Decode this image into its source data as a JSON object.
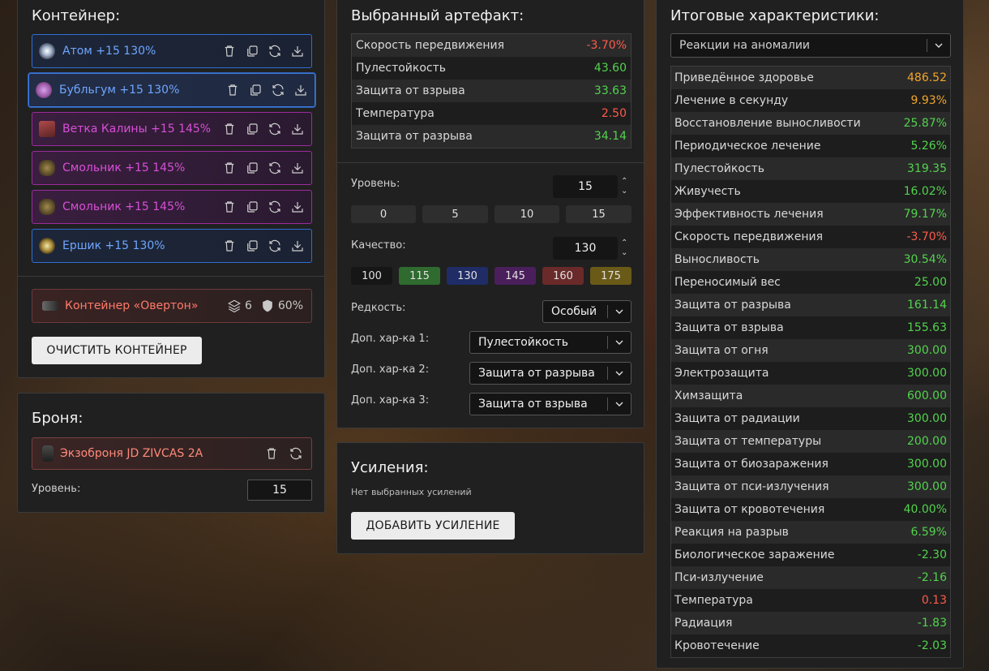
{
  "container": {
    "title": "Контейнер:",
    "artifacts": [
      {
        "label": "Атом +15 130%"
      },
      {
        "label": "Бубльгум +15 130%"
      },
      {
        "label": "Ветка Калины +15 145%"
      },
      {
        "label": "Смольник +15 145%"
      },
      {
        "label": "Смольник +15 145%"
      },
      {
        "label": "Ершик +15 130%"
      }
    ],
    "container_name": "Контейнер «Овертон»",
    "slots": "6",
    "protection": "60%",
    "clear_button": "ОЧИСТИТЬ КОНТЕЙНЕР"
  },
  "armor": {
    "title": "Броня:",
    "name": "Экзоброня JD ZIVCAS 2A",
    "level_label": "Уровень:",
    "level_value": "15"
  },
  "artifact": {
    "title": "Выбранный артефакт:",
    "stats": [
      {
        "name": "Скорость передвижения",
        "value": "-3.70%",
        "color": "red"
      },
      {
        "name": "Пулестойкость",
        "value": "43.60",
        "color": "green"
      },
      {
        "name": "Защита от взрыва",
        "value": "33.63",
        "color": "green"
      },
      {
        "name": "Температура",
        "value": "2.50",
        "color": "red"
      },
      {
        "name": "Защита от разрыва",
        "value": "34.14",
        "color": "green"
      }
    ],
    "level_label": "Уровень:",
    "level_value": "15",
    "level_quick": [
      "0",
      "5",
      "10",
      "15"
    ],
    "quality_label": "Качество:",
    "quality_value": "130",
    "quality_quick": [
      {
        "label": "100",
        "color": "#161616"
      },
      {
        "label": "115",
        "color": "#2f6a2f"
      },
      {
        "label": "130",
        "color": "#1f2c66"
      },
      {
        "label": "145",
        "color": "#4a1f5c"
      },
      {
        "label": "160",
        "color": "#6a2a2a"
      },
      {
        "label": "175",
        "color": "#6a5a18"
      }
    ],
    "rarity_label": "Редкость:",
    "rarity_value": "Особый",
    "extra1_label": "Доп. хар-ка 1:",
    "extra1_value": "Пулестойкость",
    "extra2_label": "Доп. хар-ка 2:",
    "extra2_value": "Защита от разрыва",
    "extra3_label": "Доп. хар-ка 3:",
    "extra3_value": "Защита от взрыва"
  },
  "boosts": {
    "title": "Усиления:",
    "empty_text": "Нет выбранных усилений",
    "add_button": "ДОБАВИТЬ УСИЛЕНИЕ"
  },
  "summary": {
    "title": "Итоговые характеристики:",
    "filter": "Реакции на аномалии",
    "stats": [
      {
        "name": "Приведённое здоровье",
        "value": "486.52",
        "color": "orange"
      },
      {
        "name": "Лечение в секунду",
        "value": "9.93%",
        "color": "orange"
      },
      {
        "name": "Восстановление выносливости",
        "value": "25.87%",
        "color": "green"
      },
      {
        "name": "Периодическое лечение",
        "value": "5.26%",
        "color": "green"
      },
      {
        "name": "Пулестойкость",
        "value": "319.35",
        "color": "green"
      },
      {
        "name": "Живучесть",
        "value": "16.02%",
        "color": "green"
      },
      {
        "name": "Эффективность лечения",
        "value": "79.17%",
        "color": "green"
      },
      {
        "name": "Скорость передвижения",
        "value": "-3.70%",
        "color": "red"
      },
      {
        "name": "Выносливость",
        "value": "30.54%",
        "color": "green"
      },
      {
        "name": "Переносимый вес",
        "value": "25.00",
        "color": "green"
      },
      {
        "name": "Защита от разрыва",
        "value": "161.14",
        "color": "green"
      },
      {
        "name": "Защита от взрыва",
        "value": "155.63",
        "color": "green"
      },
      {
        "name": "Защита от огня",
        "value": "300.00",
        "color": "green"
      },
      {
        "name": "Электрозащита",
        "value": "300.00",
        "color": "green"
      },
      {
        "name": "Химзащита",
        "value": "600.00",
        "color": "green"
      },
      {
        "name": "Защита от радиации",
        "value": "300.00",
        "color": "green"
      },
      {
        "name": "Защита от температуры",
        "value": "200.00",
        "color": "green"
      },
      {
        "name": "Защита от биозаражения",
        "value": "300.00",
        "color": "green"
      },
      {
        "name": "Защита от пси-излучения",
        "value": "300.00",
        "color": "green"
      },
      {
        "name": "Защита от кровотечения",
        "value": "40.00%",
        "color": "green"
      },
      {
        "name": "Реакция на разрыв",
        "value": "6.59%",
        "color": "green"
      },
      {
        "name": "Биологическое заражение",
        "value": "-2.30",
        "color": "green"
      },
      {
        "name": "Пси-излучение",
        "value": "-2.16",
        "color": "green"
      },
      {
        "name": "Температура",
        "value": "0.13",
        "color": "red"
      },
      {
        "name": "Радиация",
        "value": "-1.83",
        "color": "green"
      },
      {
        "name": "Кровотечение",
        "value": "-2.03",
        "color": "green"
      }
    ]
  }
}
